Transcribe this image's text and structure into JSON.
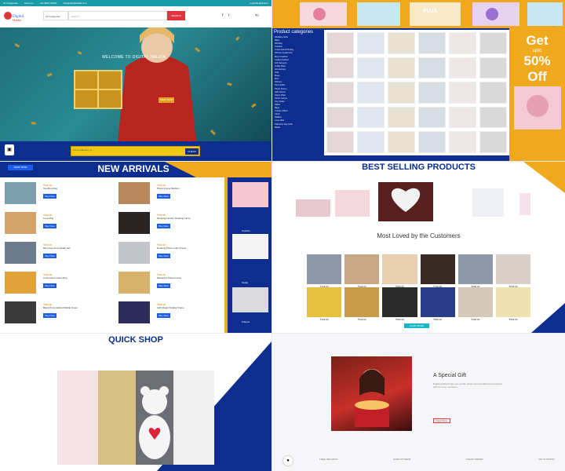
{
  "tile1": {
    "topbar": [
      "All Categories",
      "About us",
      "+91 8942 00000",
      "info@digitalhaldia.com",
      "Login/Registration"
    ],
    "logo": "Digital Haldia",
    "category_select": "All Categories",
    "search_placeholder": "Search ...",
    "search_button": "SEARCH",
    "welcome": "WELCOME TO DIGITAL HALDIA",
    "shop_now": "SHOP NOW",
    "find_placeholder": "Find a category, fi...",
    "find_button": "CHECK",
    "cart_icon": "cart-icon"
  },
  "tile2": {
    "categories_title": "Product categories",
    "categories": [
      "Wedding Gifts",
      "Baby",
      "Birthday",
      "Cushion",
      "Customized Printing",
      "Kitchen Appliances",
      "Mens Fashion",
      "Ladies Fashion",
      "Gift Hampers",
      "Teddy Bear",
      "Anniversary",
      "Kids",
      "Mugs",
      "Men",
      "Women",
      "Pen Holder",
      "Photo Frame",
      "LED Frame",
      "Name Plate",
      "Photo Lamps",
      "Key Chain",
      "Pillow",
      "Bags",
      "Combo Offers",
      "Clock",
      "Wallets",
      "Love Gifts",
      "Valentine Day Gifts",
      "Bottle"
    ],
    "banner_label": "PUJA",
    "offer_get": "Get",
    "offer_upto": "upto",
    "offer_pct": "50%",
    "offer_off": "Off"
  },
  "tile3": {
    "title": "NEW ARRIVALS",
    "shop_now": "SHOP NOW",
    "products": [
      {
        "name": "Tea Mug Mug",
        "price": "₹449.00",
        "btn": "Buy Now"
      },
      {
        "name": "Photo Frame Medium",
        "price": "₹499.00",
        "btn": "Buy Now"
      },
      {
        "name": "Love Mug",
        "price": "₹399.00",
        "btn": "Buy Now"
      },
      {
        "name": "Hanging Lantern Rotating Lamp",
        "price": "₹799.00",
        "btn": "Buy Now"
      },
      {
        "name": "Mini Cups Pen Holder Set",
        "price": "₹299.00",
        "btn": "Buy Now"
      },
      {
        "name": "Rotating Photo Cube Frame",
        "price": "₹649.00",
        "btn": "Buy Now"
      },
      {
        "name": "Customized Color Mug",
        "price": "₹299.00",
        "btn": "Buy Now"
      },
      {
        "name": "Mustache Photo Frame",
        "price": "₹349.00",
        "btn": "Buy Now"
      },
      {
        "name": "Black Personalized Mobile Cover",
        "price": "₹399.00",
        "btn": "Buy Now"
      },
      {
        "name": "LED Magic Display Frame",
        "price": "₹999.00",
        "btn": "Buy Now"
      }
    ],
    "side_labels": [
      "Cushion",
      "Teddy",
      "Frames"
    ]
  },
  "tile4": {
    "title": "BEST SELLING PRODUCTS",
    "most_loved": "Most Loved by the Customers",
    "prices": [
      "₹449.00",
      "₹349.00",
      "₹399.00",
      "₹799.00",
      "₹299.00",
      "₹649.00",
      "₹299.00",
      "₹349.00",
      "₹399.00",
      "₹999.00",
      "₹499.00",
      "₹599.00"
    ],
    "load_more": "LOAD MORE"
  },
  "tile5": {
    "title": "QUICK SHOP"
  },
  "tile6": {
    "gift_title": "A Special Gift",
    "gift_text": "Digital Haldia brings you a wide range of personalized and special gifts for every occasion.",
    "read_more": "Read More",
    "features": [
      "FREE DELIVERY",
      "SAFE PAYMENT",
      "TRACK ORDER",
      "24/7 SUPPORT"
    ]
  },
  "colors": {
    "navy": "#0d2e8f",
    "orange": "#f0a81c",
    "red": "#e0353c",
    "teal": "#1b9aa8"
  }
}
